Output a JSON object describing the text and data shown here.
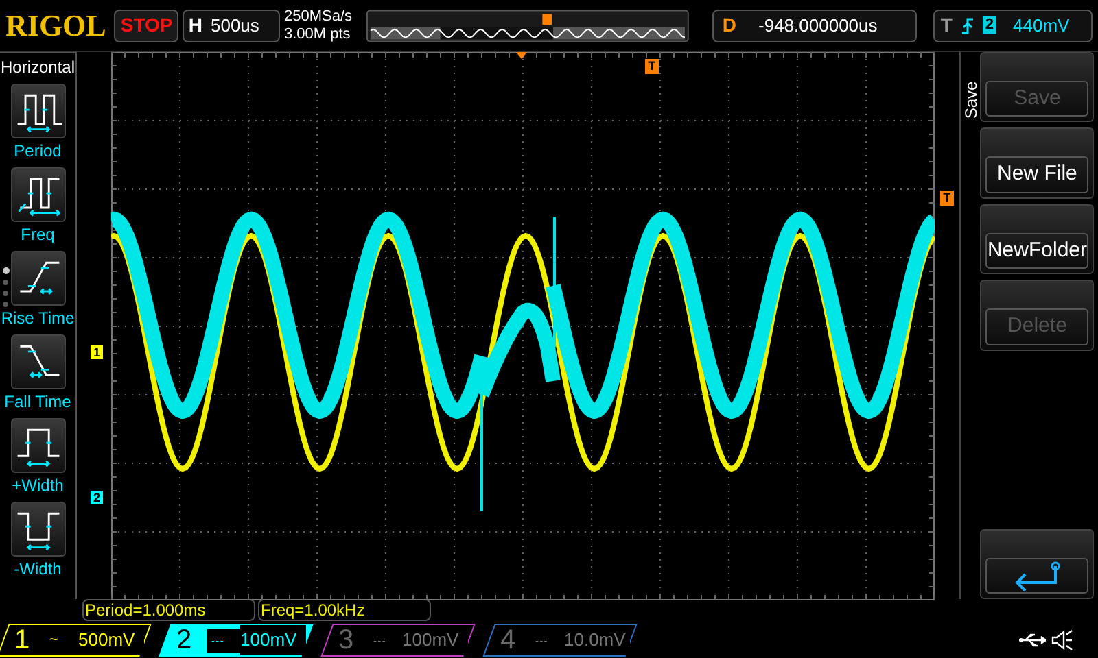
{
  "top_bar": {
    "logo": "RIGOL",
    "run_state": "STOP",
    "timebase": {
      "label": "H",
      "value": "500us"
    },
    "sample_rate": "250MSa/s",
    "memory_depth": "3.00M pts",
    "delay": {
      "label": "D",
      "value": "-948.000000us"
    },
    "trigger": {
      "label": "T",
      "source": "2",
      "level": "440mV"
    }
  },
  "left_menu": {
    "title": "Horizontal",
    "items": [
      {
        "kind": "period",
        "label": "Period"
      },
      {
        "kind": "freq",
        "label": "Freq"
      },
      {
        "kind": "rise",
        "label": "Rise Time"
      },
      {
        "kind": "fall",
        "label": "Fall Time"
      },
      {
        "kind": "pwidth",
        "label": "+Width"
      },
      {
        "kind": "nwidth",
        "label": "-Width"
      }
    ],
    "page_dots": [
      {
        "selected": true
      },
      {
        "selected": false
      },
      {
        "selected": false
      },
      {
        "selected": false
      }
    ]
  },
  "markers": {
    "trigger_position": "T",
    "trigger_level": "T",
    "channel_markers": [
      {
        "label": "1",
        "color": "#ffff00"
      },
      {
        "label": "2",
        "color": "#00ffff"
      }
    ]
  },
  "measurements": [
    "Period=1.000ms",
    "Freq=1.00kHz"
  ],
  "right_menu": {
    "title": "Save",
    "buttons": [
      {
        "kind": "text",
        "label": "Save",
        "disabled": true
      },
      {
        "kind": "text",
        "label": "New File",
        "disabled": false
      },
      {
        "kind": "text",
        "label": "NewFolder",
        "disabled": false
      },
      {
        "kind": "text",
        "label": "Delete",
        "disabled": true
      },
      {
        "kind": "back"
      }
    ]
  },
  "channels": [
    {
      "number": "1",
      "coupling": "~",
      "scale": "500mV",
      "on": true,
      "selected": false,
      "color": "#ffff00"
    },
    {
      "number": "2",
      "coupling": "⎓",
      "scale": "100mV",
      "on": true,
      "selected": true,
      "color": "#00ffff"
    },
    {
      "number": "3",
      "coupling": "⎓",
      "scale": "100mV",
      "on": false,
      "selected": false,
      "color": "#c040c0"
    },
    {
      "number": "4",
      "coupling": "⎓",
      "scale": "10.0mV",
      "on": false,
      "selected": false,
      "color": "#3070c0"
    }
  ]
}
